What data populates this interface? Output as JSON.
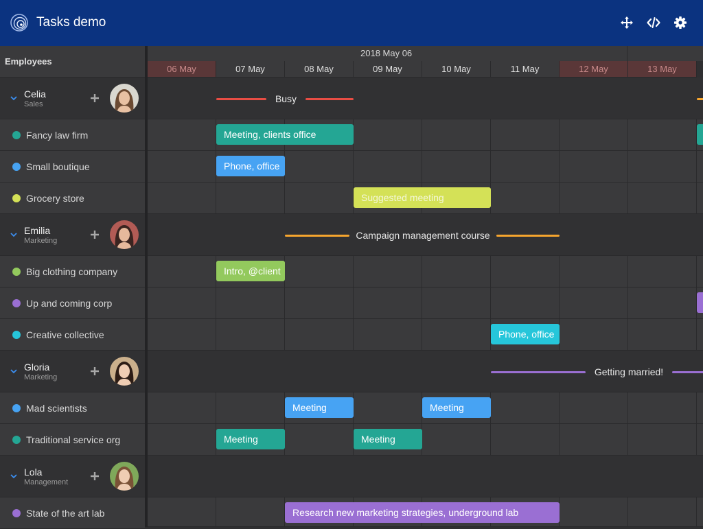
{
  "app": {
    "title": "Tasks demo"
  },
  "toolbar": {
    "icons": [
      "move-icon",
      "code-icon",
      "gear-icon"
    ]
  },
  "left": {
    "header": "Employees"
  },
  "timeline": {
    "week_label": "2018 May 06",
    "days": [
      "06 May",
      "07 May",
      "08 May",
      "09 May",
      "10 May",
      "11 May",
      "12 May",
      "13 May"
    ]
  },
  "colors": {
    "header_bg": "#0b3380",
    "weekend": "#5a3738",
    "red": "#e84d44",
    "orange": "#f6a52e",
    "purple": "#9a6fd3",
    "teal": "#24a694",
    "blue": "#47a3f3",
    "lime": "#d4e157",
    "green": "#93c95d",
    "cyan": "#26c6da"
  },
  "employees": [
    {
      "name": "Celia",
      "role": "Sales",
      "summary": "Busy",
      "tasks": [
        {
          "label": "Fancy law firm",
          "event": "Meeting, clients office"
        },
        {
          "label": "Small boutique",
          "event": "Phone, office"
        },
        {
          "label": "Grocery store",
          "event": "Suggested meeting"
        }
      ]
    },
    {
      "name": "Emilia",
      "role": "Marketing",
      "summary": "Campaign management course",
      "tasks": [
        {
          "label": "Big clothing company",
          "event": "Intro, @client"
        },
        {
          "label": "Up and coming corp",
          "event": ""
        },
        {
          "label": "Creative collective",
          "event": "Phone, office"
        }
      ]
    },
    {
      "name": "Gloria",
      "role": "Marketing",
      "summary": "Getting married!",
      "tasks": [
        {
          "label": "Mad scientists",
          "event": "Meeting",
          "event2": "Meeting"
        },
        {
          "label": "Traditional service org",
          "event": "Meeting",
          "event2": "Meeting"
        }
      ]
    },
    {
      "name": "Lola",
      "role": "Management",
      "summary": "",
      "tasks": [
        {
          "label": "State of the art lab",
          "event": "Research new marketing strategies, underground lab"
        }
      ]
    }
  ]
}
